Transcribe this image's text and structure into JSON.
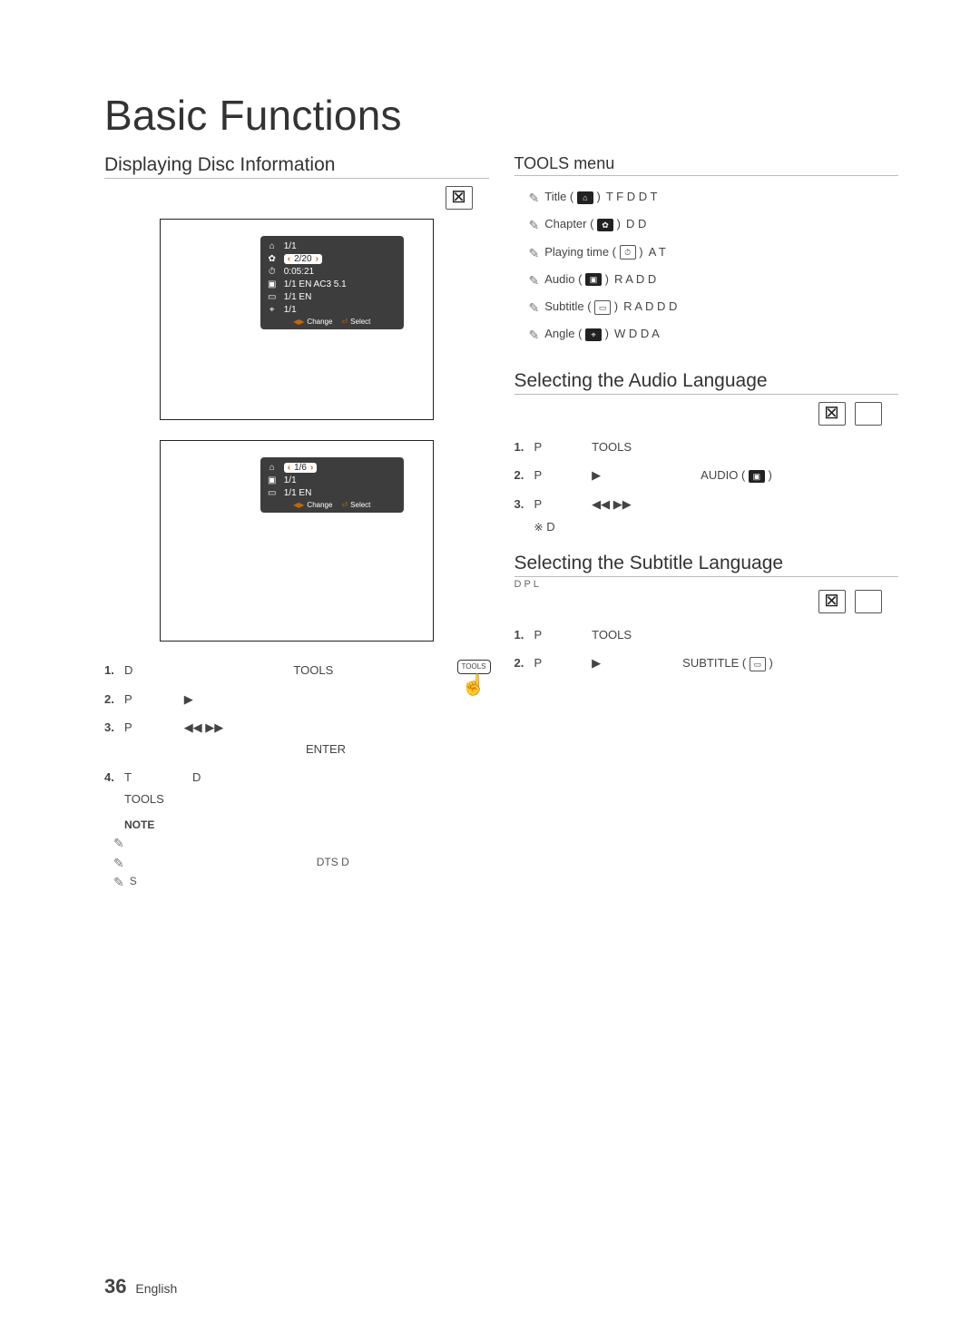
{
  "page": {
    "title": "Basic Functions",
    "number": "36",
    "lang": "English"
  },
  "left": {
    "heading": "Displaying Disc Information",
    "osd1": {
      "title": "1/1",
      "chapter": "2/20",
      "time": "0:05:21",
      "audio": "1/1 EN AC3 5.1",
      "subtitle": "1/1 EN",
      "angle": "1/1",
      "foot_change": "Change",
      "foot_select": "Select"
    },
    "osd2": {
      "title": "1/6",
      "audio": "1/1",
      "subtitle": "1/1 EN",
      "foot_change": "Change",
      "foot_select": "Select"
    },
    "steps": [
      {
        "text_a": "D",
        "text_b": "TOOLS"
      },
      {
        "text_a": "P",
        "glyph": "▶"
      },
      {
        "text_a": "P",
        "glyph": "◀◀ ▶▶",
        "tail": "ENTER"
      },
      {
        "text_a": "T",
        "mid": "D",
        "text_b": "TOOLS"
      }
    ],
    "note_label": "NOTE",
    "notes": [
      {
        "text": ""
      },
      {
        "text": "DTS   D"
      },
      {
        "text": "S"
      }
    ]
  },
  "right": {
    "tools_heading": "TOOLS menu",
    "items": [
      {
        "label": "Title",
        "icon": "⌂",
        "desc": "T   F       D D   T"
      },
      {
        "label": "Chapter",
        "icon": "✿",
        "desc": "D D"
      },
      {
        "label": "Playing time",
        "icon": "⏱",
        "desc": "A   T"
      },
      {
        "label": "Audio",
        "icon": "▣",
        "desc": "R                 A D D"
      },
      {
        "label": "Subtitle",
        "icon": "▭",
        "desc": "R           A D D D"
      },
      {
        "label": "Angle",
        "icon": "⌖",
        "desc": "W     D D   A"
      }
    ],
    "sect_audio": {
      "heading": "Selecting the Audio Language",
      "steps": [
        {
          "a": "P",
          "b": "TOOLS"
        },
        {
          "a": "P",
          "glyph": "▶",
          "tail": "AUDIO",
          "icon": "▣"
        },
        {
          "a": "P",
          "glyph": "◀◀ ▶▶"
        }
      ],
      "foot": "D"
    },
    "sect_sub": {
      "heading": "Selecting the Subtitle Language",
      "line": "D      P   L",
      "steps": [
        {
          "a": "P",
          "b": "TOOLS"
        },
        {
          "a": "P",
          "glyph": "▶",
          "tail": "SUBTITLE",
          "icon": "▭"
        }
      ]
    }
  }
}
